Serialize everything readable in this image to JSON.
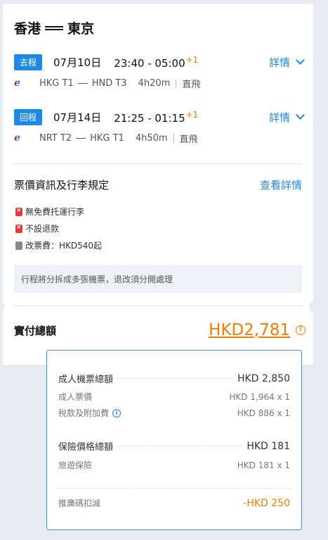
{
  "route": {
    "from": "香港",
    "to": "東京"
  },
  "outbound": {
    "badge": "去程",
    "date": "07月10日",
    "time": "23:40 - 05:00",
    "day_offset": "+1",
    "details_label": "詳情",
    "airline_icon": "airline-logo-icon",
    "dep": "HKG T1",
    "arr": "HND T3",
    "duration": "4h20m",
    "stops": "直飛"
  },
  "inbound": {
    "badge": "回程",
    "date": "07月14日",
    "time": "21:25 - 01:15",
    "day_offset": "+1",
    "details_label": "詳情",
    "airline_icon": "airline-logo-icon",
    "dep": "NRT T2",
    "arr": "HKG T1",
    "duration": "4h50m",
    "stops": "直飛"
  },
  "fare": {
    "title": "票價資訊及行李規定",
    "link": "查看詳情",
    "rules": [
      {
        "icon": "luggage-red-icon",
        "text": "無免費托運行李"
      },
      {
        "icon": "no-refund-icon",
        "text": "不設退款"
      },
      {
        "icon": "change-fee-icon",
        "text": "改票費：HKD540起"
      }
    ]
  },
  "notice": "行程將分拆成多張機票，退改須分開處理",
  "total": {
    "label": "實付總額",
    "amount": "HKD2,781"
  },
  "breakdown": {
    "adult_total_label": "成人機票總額",
    "adult_total_value": "HKD 2,850",
    "adult_fare_label": "成人票價",
    "adult_fare_value": "HKD 1,964 x 1",
    "tax_label": "稅款及附加費",
    "tax_value": "HKD 886 x 1",
    "insurance_total_label": "保險價格總額",
    "insurance_total_value": "HKD 181",
    "travel_insurance_label": "旅遊保險",
    "travel_insurance_value": "HKD 181 x 1",
    "promo_label": "推廣碼扣減",
    "promo_value": "-HKD 250"
  },
  "colors": {
    "accent": "#1e88e5",
    "price": "#f57c00",
    "airline": "#7b3fa0"
  }
}
